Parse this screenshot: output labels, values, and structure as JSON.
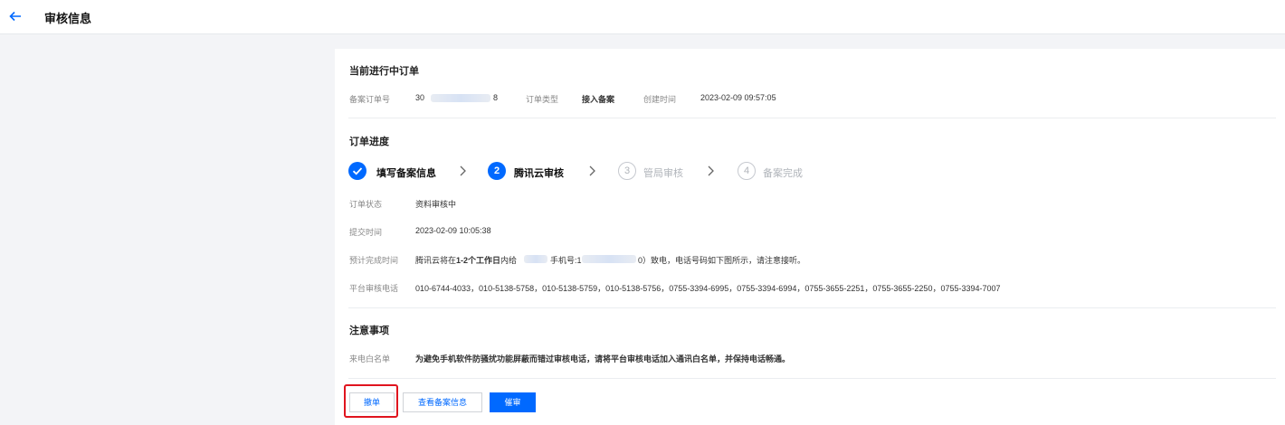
{
  "header": {
    "title": "审核信息"
  },
  "current_order": {
    "title": "当前进行中订单",
    "order_no_label": "备案订单号",
    "order_no_prefix": "30",
    "order_no_suffix": "8",
    "order_type_label": "订单类型",
    "order_type": "接入备案",
    "created_label": "创建时间",
    "created": "2023-02-09 09:57:05"
  },
  "progress": {
    "title": "订单进度",
    "steps": [
      {
        "num": "✓",
        "label": "填写备案信息",
        "state": "done"
      },
      {
        "num": "2",
        "label": "腾讯云审核",
        "state": "active"
      },
      {
        "num": "3",
        "label": "管局审核",
        "state": "pending"
      },
      {
        "num": "4",
        "label": "备案完成",
        "state": "pending"
      }
    ],
    "status_label": "订单状态",
    "status": "资料审核中",
    "submit_label": "提交时间",
    "submit_time": "2023-02-09 10:05:38",
    "eta_label": "预计完成时间",
    "eta_part1": "腾讯云将在",
    "eta_bold": "1-2个工作日",
    "eta_part2": "内给",
    "eta_part3": "手机号:1",
    "eta_part4": "0）致电，电话号码如下图所示，请注意接听。",
    "phone_label": "平台审核电话",
    "phones": "010-6744-4033，010-5138-5758，010-5138-5759，010-5138-5756，0755-3394-6995，0755-3394-6994，0755-3655-2251，0755-3655-2250，0755-3394-7007"
  },
  "notes": {
    "title": "注意事项",
    "whitelist_label": "来电白名单",
    "whitelist_text": "为避免手机软件防骚扰功能屏蔽而错过审核电话，请将平台审核电话加入通讯白名单，并保持电话畅通。"
  },
  "actions": {
    "cancel": "撤单",
    "view": "查看备案信息",
    "urge": "催审"
  },
  "colors": {
    "primary": "#0069ff",
    "highlight": "#e0141e"
  }
}
